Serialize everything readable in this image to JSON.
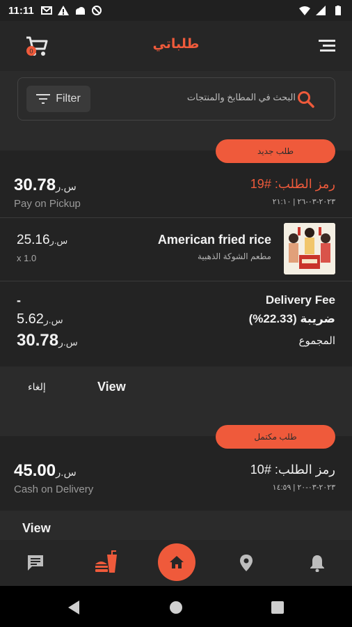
{
  "status_bar": {
    "time": "11:11"
  },
  "app_bar": {
    "title": "طلباتي",
    "cart_badge": "0"
  },
  "search": {
    "filter_label": "Filter",
    "placeholder": "البحث في المطابخ والمنتجات"
  },
  "orders": [
    {
      "status": "طلب جديد",
      "code": "رمز الطلب: #19",
      "date": "٢٠٢٣-٠٣-٢٦ | ٢١:١٠",
      "total": "30.78",
      "currency": "س.ر",
      "payment_method": "Pay on Pickup",
      "items": [
        {
          "name": "American fried rice",
          "store": "مطعم الشوكة الذهبية",
          "price": "25.16",
          "currency": "س.ر",
          "qty": "x 1.0"
        }
      ],
      "summary": {
        "delivery_fee_label": "Delivery Fee",
        "delivery_fee_value": "-",
        "tax_label": "ضريبة (22.33%)",
        "tax_value": "5.62",
        "total_label": "المجموع",
        "total_value": "30.78"
      },
      "view_label": "View",
      "cancel_label": "إلغاء"
    },
    {
      "status": "طلب مكتمل",
      "code": "رمز الطلب: #10",
      "date": "٢٠٢٣-٠٣-٢٠ | ١٤:٥٩",
      "total": "45.00",
      "currency": "س.ر",
      "payment_method": "Cash on Delivery",
      "view_label": "View"
    }
  ],
  "bottom_nav": [
    "chat-icon",
    "fastfood-icon",
    "home-icon",
    "location-icon",
    "bell-icon"
  ],
  "colors": {
    "accent": "#ef5a3b",
    "background": "#2b2b2b",
    "card": "#232323"
  }
}
